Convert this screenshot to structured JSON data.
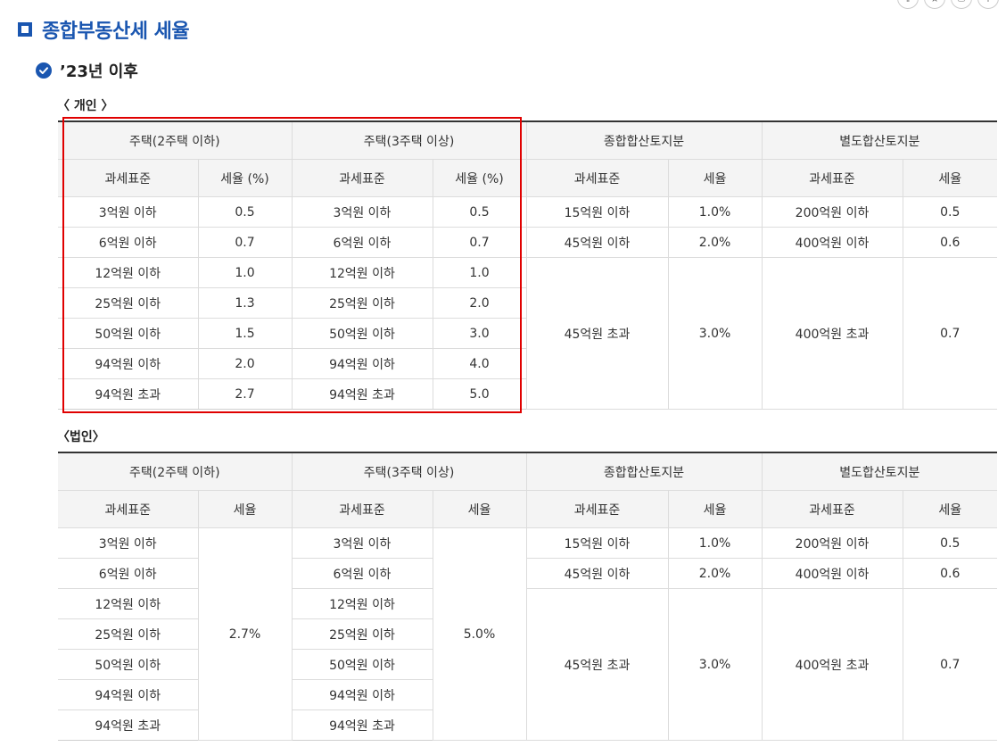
{
  "page_title": "종합부동산세 세율",
  "section_title": "’23년 이후",
  "individual": {
    "label": "〈 개인 〉",
    "groups": [
      "주택(2주택 이하)",
      "주택(3주택 이상)",
      "종합합산토지분",
      "별도합산토지분"
    ],
    "sub_headers": [
      "과세표준",
      "세율 (%)",
      "과세표준",
      "세율 (%)",
      "과세표준",
      "세율",
      "과세표준",
      "세율"
    ],
    "house2": [
      {
        "base": "3억원 이하",
        "rate": "0.5"
      },
      {
        "base": "6억원 이하",
        "rate": "0.7"
      },
      {
        "base": "12억원 이하",
        "rate": "1.0"
      },
      {
        "base": "25억원 이하",
        "rate": "1.3"
      },
      {
        "base": "50억원 이하",
        "rate": "1.5"
      },
      {
        "base": "94억원 이하",
        "rate": "2.0"
      },
      {
        "base": "94억원 초과",
        "rate": "2.7"
      }
    ],
    "house3": [
      {
        "base": "3억원 이하",
        "rate": "0.5"
      },
      {
        "base": "6억원 이하",
        "rate": "0.7"
      },
      {
        "base": "12억원 이하",
        "rate": "1.0"
      },
      {
        "base": "25억원 이하",
        "rate": "2.0"
      },
      {
        "base": "50억원 이하",
        "rate": "3.0"
      },
      {
        "base": "94억원 이하",
        "rate": "4.0"
      },
      {
        "base": "94억원 초과",
        "rate": "5.0"
      }
    ],
    "comprehensive_land": [
      {
        "base": "15억원 이하",
        "rate": "1.0%"
      },
      {
        "base": "45억원 이하",
        "rate": "2.0%"
      },
      {
        "base": "45억원 초과",
        "rate": "3.0%"
      }
    ],
    "separate_land": [
      {
        "base": "200억원 이하",
        "rate": "0.5"
      },
      {
        "base": "400억원 이하",
        "rate": "0.6"
      },
      {
        "base": "400억원 초과",
        "rate": "0.7"
      }
    ]
  },
  "corporate": {
    "label": "〈법인〉",
    "groups": [
      "주택(2주택 이하)",
      "주택(3주택 이상)",
      "종합합산토지분",
      "별도합산토지분"
    ],
    "sub_headers": [
      "과세표준",
      "세율",
      "과세표준",
      "세율",
      "과세표준",
      "세율",
      "과세표준",
      "세율"
    ],
    "house2_bases": [
      "3억원 이하",
      "6억원 이하",
      "12억원 이하",
      "25억원 이하",
      "50억원 이하",
      "94억원 이하",
      "94억원 초과"
    ],
    "house2_rate": "2.7%",
    "house3_bases": [
      "3억원 이하",
      "6억원 이하",
      "12억원 이하",
      "25억원 이하",
      "50억원 이하",
      "94억원 이하",
      "94억원 초과"
    ],
    "house3_rate": "5.0%",
    "comprehensive_land": [
      {
        "base": "15억원 이하",
        "rate": "1.0%"
      },
      {
        "base": "45억원 이하",
        "rate": "2.0%"
      },
      {
        "base": "45억원 초과",
        "rate": "3.0%"
      }
    ],
    "separate_land": [
      {
        "base": "200억원 이하",
        "rate": "0.5"
      },
      {
        "base": "400억원 이하",
        "rate": "0.6"
      },
      {
        "base": "400억원 초과",
        "rate": "0.7"
      }
    ]
  },
  "colors": {
    "accent": "#1a56b0",
    "highlight": "#e00000"
  }
}
